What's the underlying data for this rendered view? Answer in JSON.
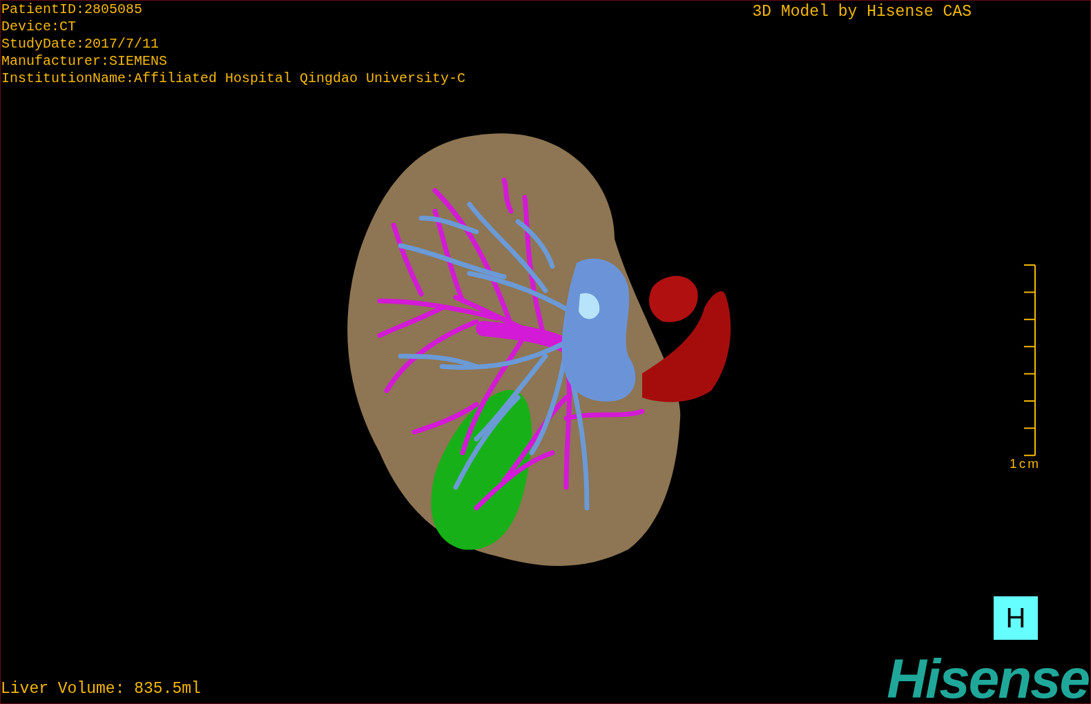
{
  "patient_info": [
    "PatientID:2805085",
    "Device:CT",
    "StudyDate:2017/7/11",
    "Manufacturer:SIEMENS",
    "InstitutionName:Affiliated Hospital Qingdao University-C"
  ],
  "title": "3D Model by Hisense CAS",
  "scale_bar": {
    "label": "1cm"
  },
  "view_button": {
    "label": "H"
  },
  "liver_volume": "Liver Volume: 835.5ml",
  "logo": "Hisense"
}
